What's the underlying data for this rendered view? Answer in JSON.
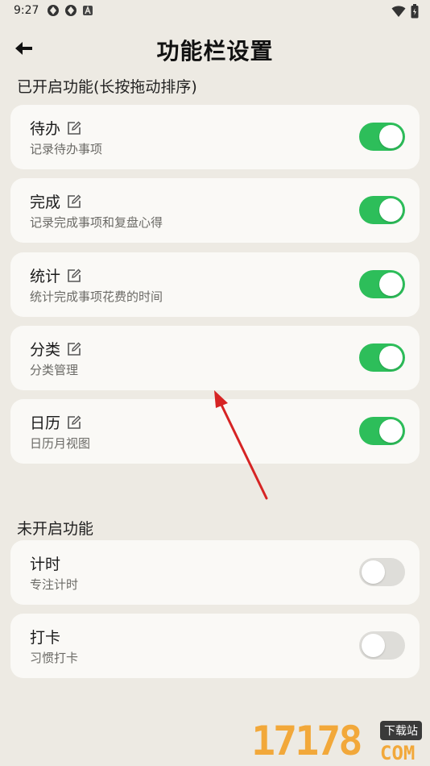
{
  "status_bar": {
    "time": "9:27",
    "icons_left": [
      "app-icon",
      "app-icon",
      "a-icon"
    ],
    "icons_right": [
      "wifi-icon",
      "battery-icon"
    ]
  },
  "header": {
    "title": "功能栏设置"
  },
  "enabled_section": {
    "title": "已开启功能(长按拖动排序)",
    "items": [
      {
        "title": "待办",
        "subtitle": "记录待办事项",
        "enabled": true
      },
      {
        "title": "完成",
        "subtitle": "记录完成事项和复盘心得",
        "enabled": true
      },
      {
        "title": "统计",
        "subtitle": "统计完成事项花费的时间",
        "enabled": true
      },
      {
        "title": "分类",
        "subtitle": "分类管理",
        "enabled": true
      },
      {
        "title": "日历",
        "subtitle": "日历月视图",
        "enabled": true
      }
    ]
  },
  "disabled_section": {
    "title": "未开启功能",
    "items": [
      {
        "title": "计时",
        "subtitle": "专注计时",
        "enabled": false
      },
      {
        "title": "打卡",
        "subtitle": "习惯打卡",
        "enabled": false
      }
    ]
  },
  "watermark": {
    "number": "17178",
    "tag": "下载站",
    "domain": "COM"
  },
  "colors": {
    "background": "#EDEAE3",
    "card": "#FAF9F6",
    "toggle_on": "#2DBE5A",
    "toggle_off": "#DEDDD9",
    "annotation_arrow": "#D62424",
    "watermark": "#F2A83A"
  }
}
